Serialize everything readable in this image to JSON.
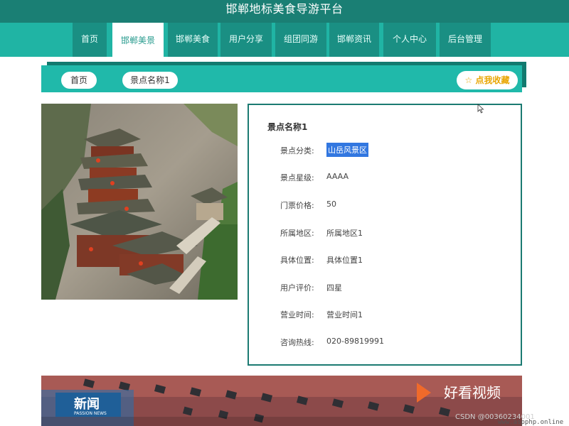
{
  "app": {
    "title": "邯郸地标美食导游平台"
  },
  "nav": {
    "items": [
      {
        "label": "首页"
      },
      {
        "label": "邯郸美景"
      },
      {
        "label": "邯郸美食"
      },
      {
        "label": "用户分享"
      },
      {
        "label": "组团同游"
      },
      {
        "label": "邯郸资讯"
      },
      {
        "label": "个人中心"
      },
      {
        "label": "后台管理"
      }
    ],
    "active": "邯郸美景"
  },
  "breadcrumb": {
    "home": "首页",
    "current": "景点名称1",
    "favorite": "☆ 点我收藏"
  },
  "detail": {
    "title": "景点名称1",
    "fields": [
      {
        "label": "景点分类:",
        "value": "山岳风景区"
      },
      {
        "label": "景点星级:",
        "value": "AAAA"
      },
      {
        "label": "门票价格:",
        "value": "50"
      },
      {
        "label": "所属地区:",
        "value": "所属地区1"
      },
      {
        "label": "具体位置:",
        "value": "具体位置1"
      },
      {
        "label": "用户评价:",
        "value": "四星"
      },
      {
        "label": "营业时间:",
        "value": "营业时间1"
      },
      {
        "label": "咨询热线:",
        "value": "020-89819991"
      }
    ]
  },
  "video": {
    "news_logo": "新闻",
    "news_sub": "PASSION NEWS",
    "brand": "好看视频"
  },
  "watermark": {
    "csdn": "CSDN @00360234001",
    "site": "www.aspphp.online"
  },
  "colors": {
    "header": "#1a7f74",
    "nav": "#20b4a4",
    "accent": "#20b9aa",
    "border": "#1b7a72"
  }
}
